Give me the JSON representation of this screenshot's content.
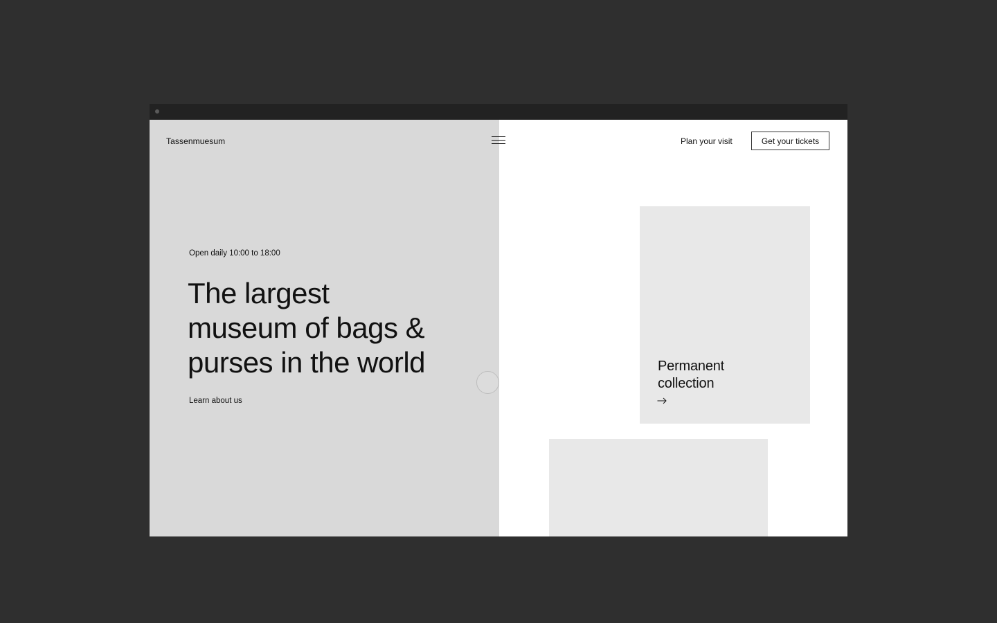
{
  "header": {
    "brand": "Tassenmuesum",
    "nav_plan_visit": "Plan your visit",
    "tickets_label": "Get your tickets"
  },
  "hero": {
    "hours": "Open daily 10:00 to 18:00",
    "headline_lines": [
      "The largest",
      "museum of bags &",
      "purses in the world"
    ],
    "learn_link": "Learn about us"
  },
  "cards": {
    "permanent_lines": [
      "Permanent",
      "collection"
    ]
  },
  "colors": {
    "background": "#2f2f2f",
    "hero_panel": "#d9d9d9",
    "card": "#e8e8e8",
    "text": "#111111"
  },
  "icons": {
    "menu": "hamburger-icon",
    "card_arrow": "arrow-right-icon"
  }
}
